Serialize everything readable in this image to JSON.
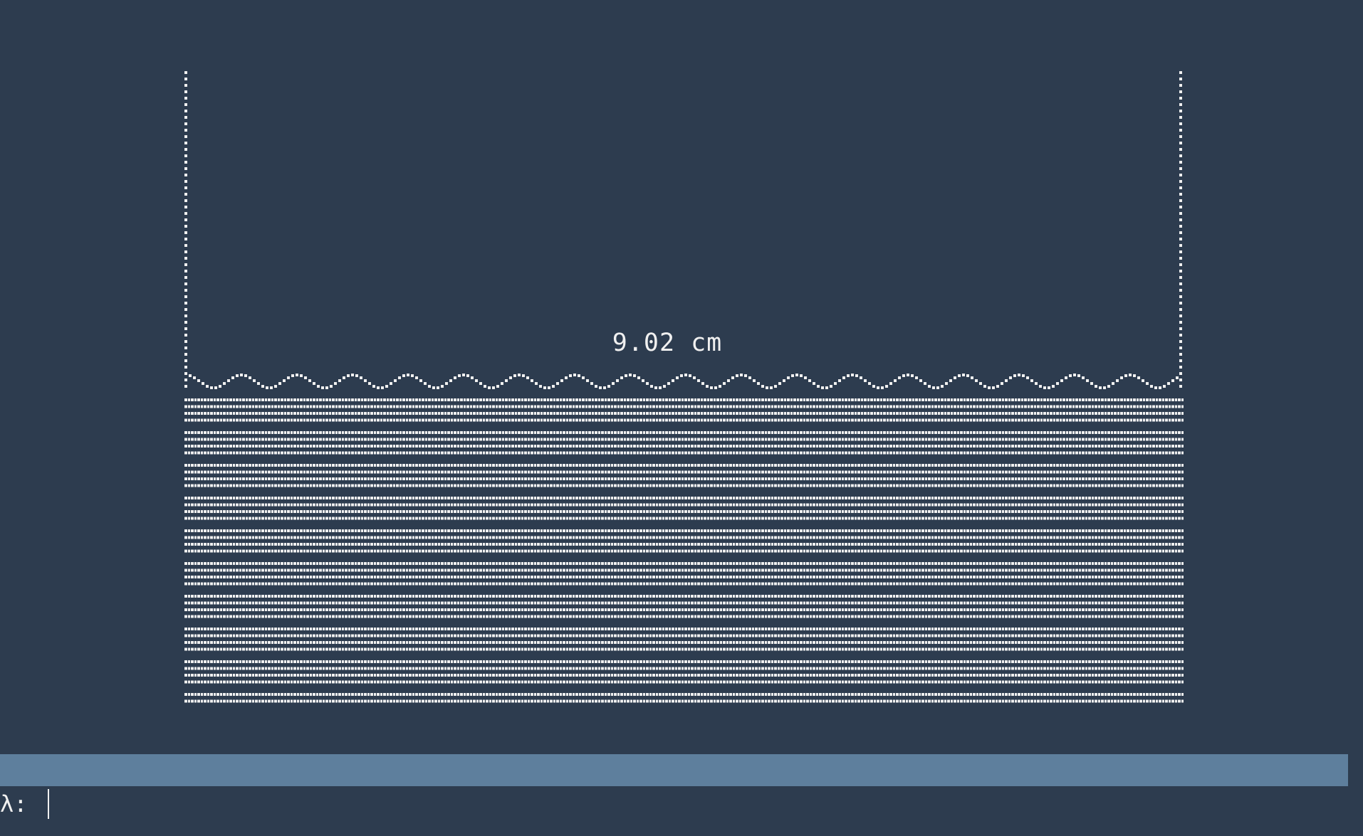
{
  "app": {
    "level_label": "9.02 cm",
    "level_value_cm": 9.02
  },
  "tank": {
    "fill_fraction": 0.55,
    "dot_color": "#f0f0f0",
    "background_color": "#2d3c4f"
  },
  "status_bar": {
    "color": "#5e7f9d"
  },
  "prompt": {
    "symbol": "λ:",
    "value": "",
    "placeholder": ""
  }
}
